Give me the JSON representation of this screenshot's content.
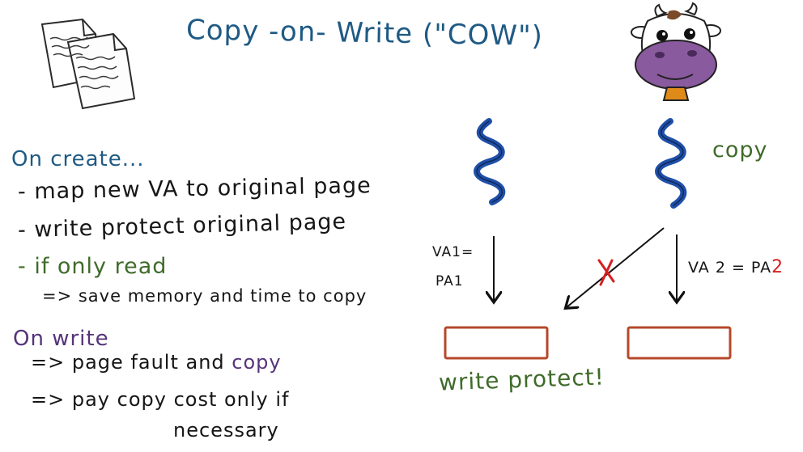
{
  "title": "Copy -on- Write (\"COW\")",
  "left_notes": {
    "on_create": {
      "heading": "On create...",
      "items": [
        "- map new VA to original page",
        "- write protect original page"
      ],
      "if_read": "- if only read",
      "benefit": "=> save memory and time to copy"
    },
    "on_write": {
      "heading": "On write",
      "line1_prefix": "=> page fault and ",
      "line1_highlight": "copy",
      "line2": "=> pay copy cost only if",
      "line3": "necessary"
    }
  },
  "diagram": {
    "copy_label": "copy",
    "left_mapping": {
      "line1": "VA1=",
      "line2": "PA1"
    },
    "right_mapping": {
      "text": "VA 2 = PA",
      "highlight": "2"
    },
    "caption": "write protect!"
  },
  "colors": {
    "title": "#1f5a84",
    "heading_create": "#1f5a84",
    "green_text": "#3f6b2a",
    "heading_write": "#55347a",
    "thread_squiggle": "#1f4fa8",
    "page_box": "#b5482a",
    "red_mark": "#d62020"
  },
  "icons": [
    "documents-icon",
    "cow-icon"
  ]
}
